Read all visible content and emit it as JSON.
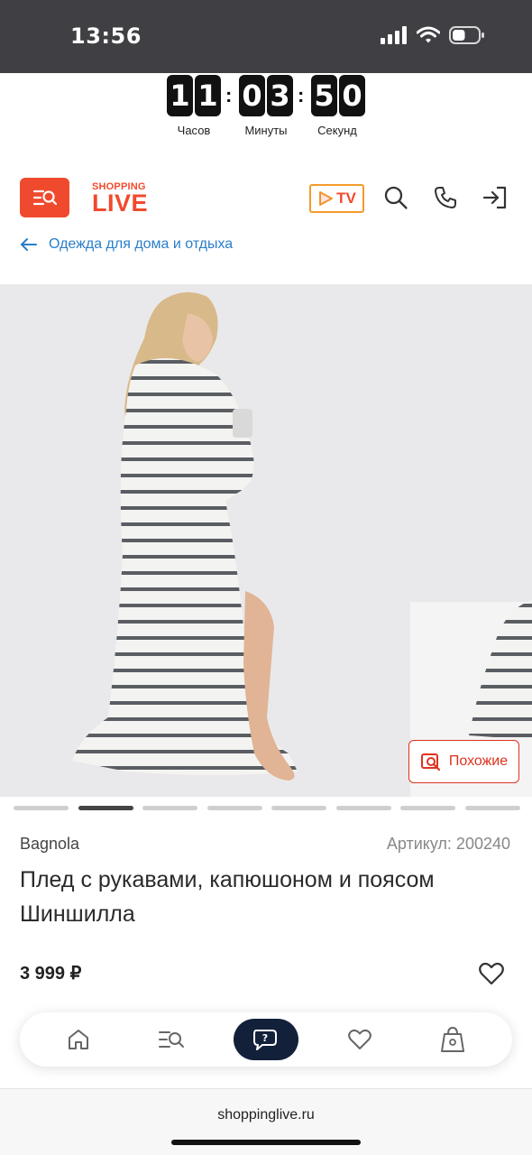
{
  "status_bar": {
    "time": "13:56",
    "battery_level": 0.5
  },
  "countdown": {
    "hours": [
      "1",
      "1"
    ],
    "minutes": [
      "0",
      "3"
    ],
    "seconds": [
      "5",
      "0"
    ],
    "separator": ":",
    "labels": {
      "hours": "Часов",
      "minutes": "Минуты",
      "seconds": "Секунд"
    }
  },
  "header": {
    "logo_top": "SHOPPING",
    "logo_bottom": "LIVE",
    "tv_label": "TV",
    "icons": [
      "menu-search-icon",
      "tv-play-icon",
      "search-icon",
      "phone-icon",
      "login-icon"
    ]
  },
  "breadcrumb": {
    "label": "Одежда для дома и отдыха"
  },
  "gallery": {
    "similar_label": "Похожие",
    "image_count": 8,
    "active_index": 1
  },
  "product": {
    "brand": "Bagnola",
    "sku": "Артикул: 200240",
    "title": "Плед с рукавами, капюшоном и поясом Шиншилла",
    "price": "3 999 ₽"
  },
  "bottom_nav": {
    "items": [
      "home-icon",
      "catalog-icon",
      "chat-support-icon",
      "favorites-icon",
      "cart-icon"
    ],
    "active": "chat-support-icon"
  },
  "browser": {
    "url": "shoppinglive.ru"
  },
  "colors": {
    "brand_red": "#f04a2e",
    "link_blue": "#2a7ec9",
    "nav_dark": "#13203a",
    "tv_border": "#f39a2b"
  }
}
